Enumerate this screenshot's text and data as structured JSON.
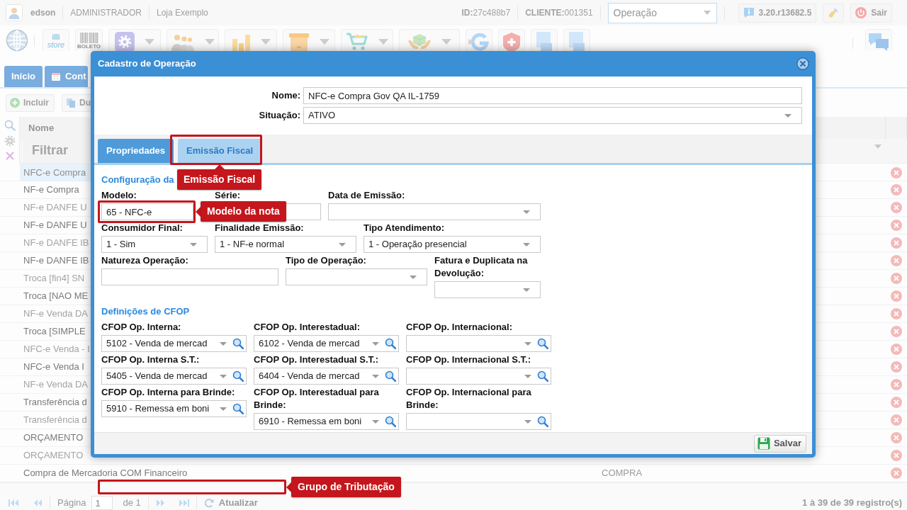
{
  "top_bar": {
    "user": "edson",
    "role": "ADMINISTRADOR",
    "store": "Loja Exemplo",
    "session_id": "**ID:**27c488b7",
    "client": "**CLIENTE:**001351",
    "module_select": "Operação",
    "version": "3.20.r13682.5",
    "logout": "Sair"
  },
  "toolbar": [
    {
      "kind": "logo"
    },
    {
      "kind": "store",
      "lines": [
        "illi",
        "store"
      ]
    },
    {
      "kind": "barcode",
      "caption": "BOLETO"
    },
    {
      "kind": "gear",
      "menu": true
    },
    {
      "kind": "people",
      "menu": true
    },
    {
      "kind": "coins",
      "menu": true
    },
    {
      "kind": "box",
      "menu": true
    },
    {
      "kind": "cart",
      "menu": true
    },
    {
      "kind": "hands",
      "menu": true
    },
    {
      "kind": "arrow",
      "menu": false
    },
    {
      "kind": "shield",
      "menu": false
    },
    {
      "kind": "document",
      "menu": false
    },
    {
      "kind": "document",
      "menu": false
    },
    {
      "kind": "chat",
      "menu": false
    }
  ],
  "tabs": [
    {
      "label": "Início",
      "kind": "plain"
    },
    {
      "label": "Cont",
      "kind": "calendar"
    }
  ],
  "list_toolbar": [
    {
      "label": "Incluir",
      "kind": "add"
    },
    {
      "label": "Du",
      "kind": "copy"
    }
  ],
  "grid": {
    "columns": [
      {
        "label": "Nome"
      }
    ],
    "filter_placeholder": "Filtrar",
    "rows": [
      {
        "name": "NFC-e Compra",
        "selected": true
      },
      {
        "name": "NF-e Compra",
        "selected": false
      },
      {
        "name": "NF-e DANFE U",
        "selected": false
      },
      {
        "name": "NF-e DANFE U",
        "selected": false
      },
      {
        "name": "NF-e DANFE IB",
        "selected": false
      },
      {
        "name": "NF-e DANFE IB",
        "selected": false
      },
      {
        "name": "Troca [fin4] SN",
        "selected": false
      },
      {
        "name": "Troca [NAO ME",
        "selected": false
      },
      {
        "name": "NF-e Venda DA",
        "selected": false
      },
      {
        "name": "Troca [SIMPLE",
        "selected": false
      },
      {
        "name": "NFC-e Venda - I",
        "selected": false
      },
      {
        "name": "NFC-e Venda I",
        "selected": false
      },
      {
        "name": "NF-e Venda DA",
        "selected": false
      },
      {
        "name": "Transferência d",
        "selected": false
      },
      {
        "name": "Transferência d",
        "selected": false
      },
      {
        "name": "ORÇAMENTO",
        "selected": false
      },
      {
        "name": "ORÇAMENTO",
        "selected": false
      },
      {
        "name": "Compra de Mercadoria COM Financeiro",
        "type": "COMPRA",
        "selected": false
      }
    ]
  },
  "pager": {
    "page_label": "Página",
    "page": "1",
    "total": "de 1",
    "refresh": "Atualizar",
    "summary": "1 à 39 de 39 registro(s)"
  },
  "dialog": {
    "title": "Cadastro de Operação",
    "header_fields": [
      {
        "label": "Nome:",
        "value": "NFC-e Compra Gov QA IL-1759",
        "kind": "text"
      },
      {
        "label": "Situação:",
        "value": "ATIVO",
        "kind": "select"
      }
    ],
    "tabs": [
      {
        "label": "Propriedades",
        "selected": false
      },
      {
        "label": "Emissão Fiscal",
        "selected": true
      }
    ],
    "sections": [
      {
        "title": "Configuração da",
        "rows": [
          [
            {
              "label": "Modelo:",
              "value": "65 - NFC-e",
              "kind": "text"
            },
            {
              "label": "Série:",
              "kind": "text"
            },
            {
              "label": "Data de Emissão:",
              "kind": "select"
            }
          ],
          [
            {
              "label": "Consumidor Final:",
              "value": "1 - Sim",
              "kind": "select"
            },
            {
              "label": "Finalidade Emissão:",
              "value": "1 - NF-e normal",
              "kind": "select"
            },
            {
              "label": "Tipo Atendimento:",
              "value": "1 - Operação presencial",
              "kind": "select"
            }
          ],
          [
            {
              "label": "Natureza Operação:",
              "kind": "text"
            },
            {
              "label": "Tipo de Operação:",
              "kind": "select"
            },
            {
              "label": "Fatura e Duplicata na Devolução:",
              "kind": "select"
            }
          ]
        ]
      },
      {
        "title": "Definições de CFOP",
        "rows": [
          [
            {
              "label": "CFOP Op. Interna:",
              "value": "5102 - Venda de mercad",
              "kind": "lookup"
            },
            {
              "label": "CFOP Op. Interestadual:",
              "value": "6102 - Venda de mercad",
              "kind": "lookup"
            },
            {
              "label": "CFOP Op. Internacional:",
              "kind": "lookup"
            }
          ],
          [
            {
              "label": "CFOP Op. Interna S.T.:",
              "value": "5405 - Venda de mercad",
              "kind": "lookup"
            },
            {
              "label": "CFOP Op. Interestadual S.T.:",
              "value": "6404 - Venda de mercad",
              "kind": "lookup"
            },
            {
              "label": "CFOP Op. Internacional S.T.:",
              "kind": "lookup"
            }
          ],
          [
            {
              "label": "CFOP Op. Interna para Brinde:",
              "value": "5910 - Remessa em boni",
              "kind": "lookup"
            },
            {
              "label": "CFOP Op. Interestadual para Brinde:",
              "value": "6910 - Remessa em boni",
              "kind": "lookup"
            },
            {
              "label": "CFOP Op. Internacional para Brinde:",
              "kind": "lookup"
            }
          ]
        ]
      }
    ],
    "save_button": "Salvar"
  },
  "annotations": [
    {
      "kind": "frame"
    },
    {
      "kind": "callout",
      "text": "Emissão Fiscal",
      "points_up": true
    },
    {
      "kind": "frame"
    },
    {
      "kind": "callout",
      "text": "Modelo da nota",
      "points_up": false
    },
    {
      "kind": "frame"
    },
    {
      "kind": "callout",
      "text": "Grupo de Tributação",
      "points_up": false
    }
  ]
}
